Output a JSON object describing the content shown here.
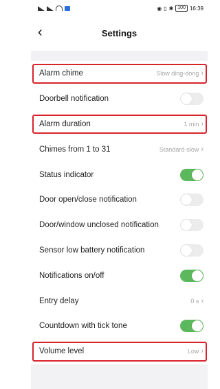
{
  "statusbar": {
    "left_icons": [
      "signal-icon",
      "signal-icon",
      "wifi-icon",
      "message-icon"
    ],
    "right_icons": [
      "eye-icon",
      "vibrate-icon",
      "bluetooth-icon"
    ],
    "battery": "100",
    "time": "16:39"
  },
  "header": {
    "title": "Settings",
    "back_icon": "chevron-left-icon"
  },
  "settings": [
    {
      "label": "Alarm chime",
      "value": "Slow ding-dong",
      "highlighted": true
    },
    {
      "label": "Doorbell notification",
      "toggle": false
    },
    {
      "label": "Alarm duration",
      "value": "1 min",
      "highlighted": true
    },
    {
      "label": "Chimes from 1 to 31",
      "value": "Standard-slow"
    },
    {
      "label": "Status indicator",
      "toggle": true
    },
    {
      "label": "Door open/close notification",
      "toggle": false
    },
    {
      "label": "Door/window unclosed notification",
      "toggle": false
    },
    {
      "label": "Sensor low battery notification",
      "toggle": false
    },
    {
      "label": "Notifications on/off",
      "toggle": true
    },
    {
      "label": "Entry delay",
      "value": "0 s"
    },
    {
      "label": "Countdown with tick tone",
      "toggle": true
    },
    {
      "label": "Volume level",
      "value": "Low",
      "highlighted": true
    }
  ],
  "colors": {
    "toggle_on": "#5cb85c",
    "toggle_off": "#ececec",
    "highlight": "#d8232a",
    "background": "#f2f2f4"
  }
}
